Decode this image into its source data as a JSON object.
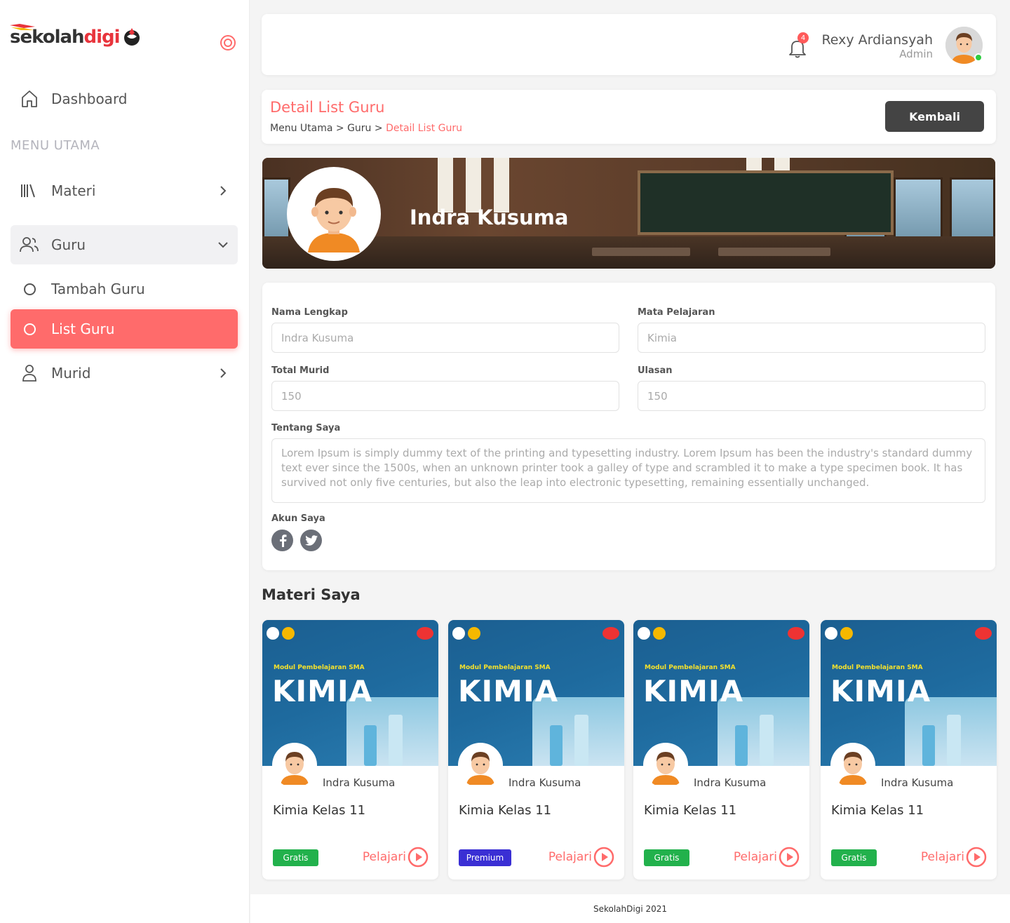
{
  "brand": {
    "logo_part1": "sekolah",
    "logo_part2": "digi"
  },
  "sidebar": {
    "dashboard_label": "Dashboard",
    "menu_header": "MENU UTAMA",
    "items": [
      {
        "label": "Materi"
      },
      {
        "label": "Guru"
      },
      {
        "label": "Tambah Guru"
      },
      {
        "label": "List Guru"
      },
      {
        "label": "Murid"
      }
    ]
  },
  "topbar": {
    "notification_count": "4",
    "user_name": "Rexy Ardiansyah",
    "user_role": "Admin"
  },
  "page": {
    "title": "Detail List Guru",
    "breadcrumb": [
      "Menu Utama",
      ">",
      "Guru",
      ">",
      "Detail List Guru"
    ],
    "back_button": "Kembali"
  },
  "profile": {
    "name": "Indra Kusuma"
  },
  "form": {
    "name_label": "Nama Lengkap",
    "name_value": "Indra Kusuma",
    "subject_label": "Mata Pelajaran",
    "subject_value": "Kimia",
    "students_label": "Total Murid",
    "students_value": "150",
    "reviews_label": "Ulasan",
    "reviews_value": "150",
    "about_label": "Tentang Saya",
    "about_value": "Lorem Ipsum is simply dummy text of the printing and typesetting industry. Lorem Ipsum has been the industry's standard dummy text ever since the 1500s, when an unknown printer took a galley of type and scrambled it to make a type specimen book. It has survived not only five centuries, but also the leap into electronic typesetting, remaining essentially unchanged.",
    "account_label": "Akun Saya"
  },
  "materials": {
    "section_title": "Materi Saya",
    "cover_subtitle": "Modul Pembelajaran SMA",
    "cover_title": "KIMIA",
    "cards": [
      {
        "teacher": "Indra Kusuma",
        "title": "Kimia Kelas 11",
        "badge": "Gratis",
        "badge_color": "#22b14c",
        "action": "Pelajari"
      },
      {
        "teacher": "Indra Kusuma",
        "title": "Kimia Kelas 11",
        "badge": "Premium",
        "badge_color": "#3a2fd4",
        "action": "Pelajari"
      },
      {
        "teacher": "Indra Kusuma",
        "title": "Kimia Kelas 11",
        "badge": "Gratis",
        "badge_color": "#22b14c",
        "action": "Pelajari"
      },
      {
        "teacher": "Indra Kusuma",
        "title": "Kimia Kelas 11",
        "badge": "Gratis",
        "badge_color": "#22b14c",
        "action": "Pelajari"
      }
    ]
  },
  "footer": {
    "text": "SekolahDigi 2021"
  },
  "colors": {
    "accent": "#ff6b6b",
    "dark_button": "#444444"
  }
}
